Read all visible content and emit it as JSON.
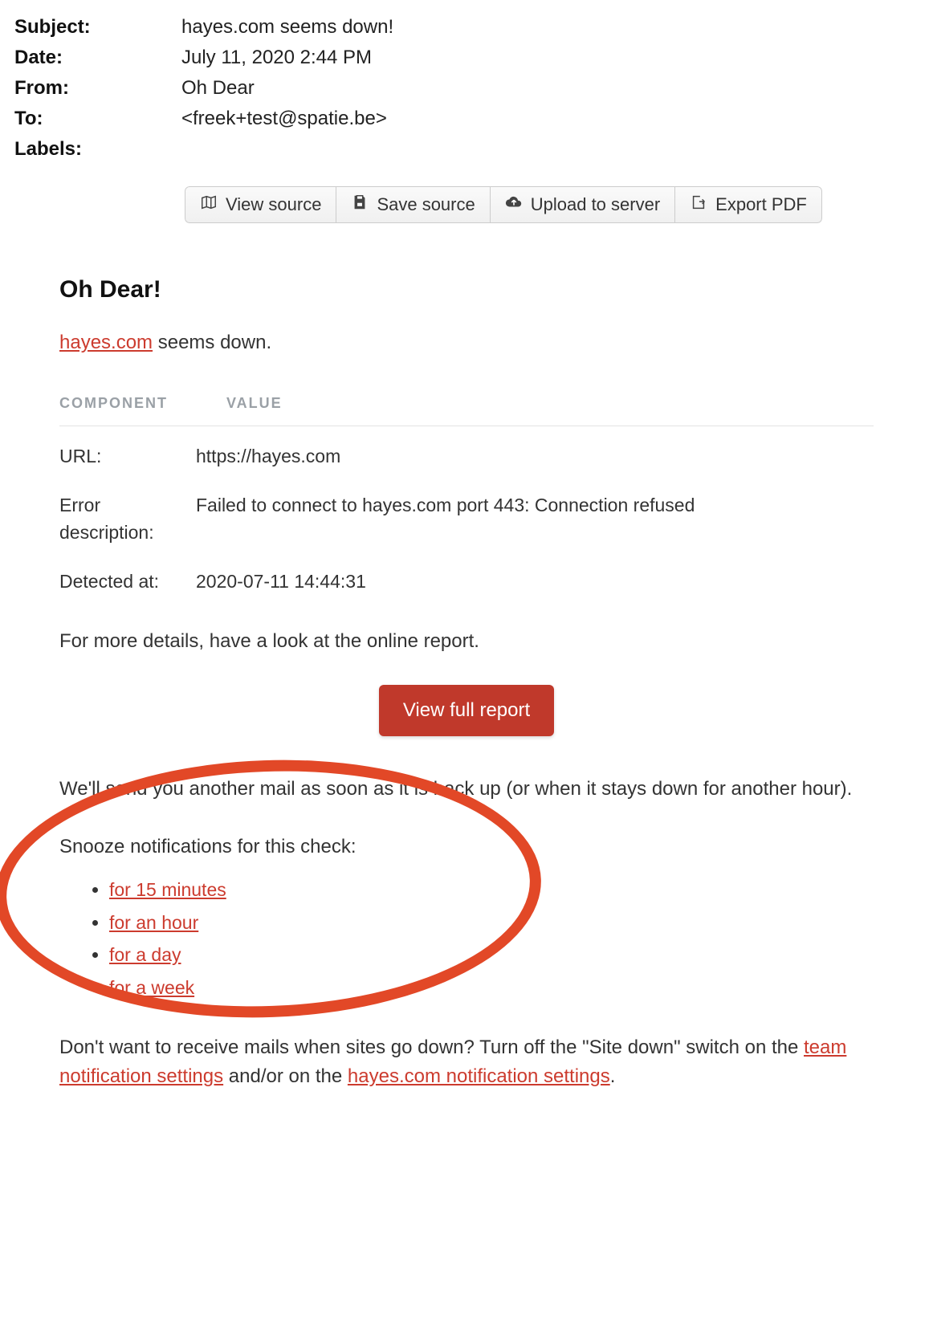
{
  "header": {
    "subject_label": "Subject:",
    "subject_value": "hayes.com seems down!",
    "date_label": "Date:",
    "date_value": "July 11, 2020 2:44 PM",
    "from_label": "From:",
    "from_value": "Oh Dear",
    "to_label": "To:",
    "to_value": "<freek+test@spatie.be>",
    "labels_label": "Labels:",
    "labels_value": ""
  },
  "toolbar": {
    "view_source": "View source",
    "save_source": "Save source",
    "upload": "Upload to server",
    "export_pdf": "Export PDF"
  },
  "email": {
    "title": "Oh Dear!",
    "lead_link": "hayes.com",
    "lead_rest": " seems down.",
    "table_headers": {
      "component": "COMPONENT",
      "value": "VALUE"
    },
    "rows": {
      "url_label": "URL:",
      "url_value": "https://hayes.com",
      "error_label": "Error description:",
      "error_value": "Failed to connect to hayes.com port 443: Connection refused",
      "detected_label": "Detected at:",
      "detected_value": "2020-07-11 14:44:31"
    },
    "details_text": "For more details, have a look at the online report.",
    "cta": "View full report",
    "followup": "We'll send you another mail as soon as it is back up (or when it stays down for another hour).",
    "snooze_prompt": "Snooze notifications for this check:",
    "snooze": {
      "m15": "for 15 minutes",
      "hour": "for an hour",
      "day": "for a day",
      "week": "for a week"
    },
    "footer_pre": "Don't want to receive mails when sites go down? Turn off the \"Site down\" switch on the ",
    "footer_link1": "team notification settings",
    "footer_mid": " and/or on the ",
    "footer_link2": "hayes.com notification settings",
    "footer_post": "."
  }
}
